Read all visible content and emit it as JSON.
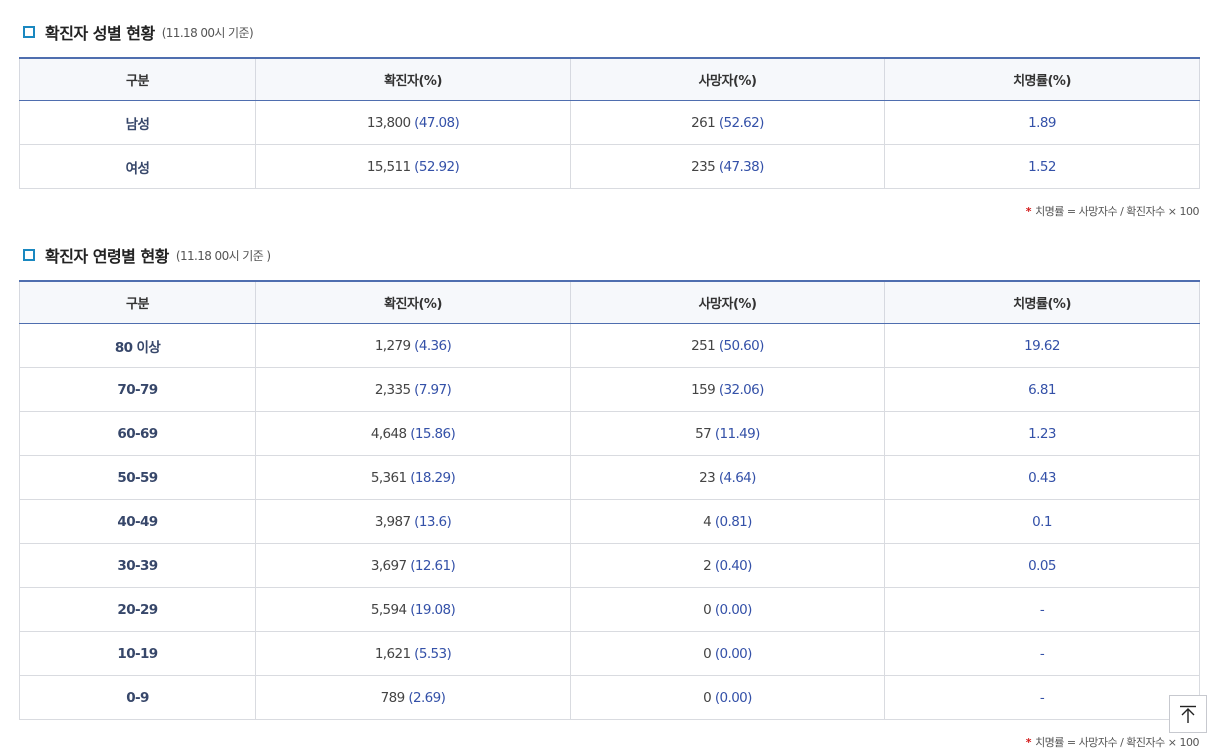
{
  "gender_section": {
    "title": "확진자 성별 현황",
    "subtitle": "(11.18 00시 기준)",
    "headers": [
      "구분",
      "확진자(%)",
      "사망자(%)",
      "치명률(%)"
    ],
    "rows": [
      {
        "group": "남성",
        "confirmed": "13,800",
        "confirmed_pct": "(47.08)",
        "deaths": "261",
        "deaths_pct": "(52.62)",
        "fatality": "1.89"
      },
      {
        "group": "여성",
        "confirmed": "15,511",
        "confirmed_pct": "(52.92)",
        "deaths": "235",
        "deaths_pct": "(47.38)",
        "fatality": "1.52"
      }
    ],
    "note_star": "*",
    "note": "치명률 = 사망자수 / 확진자수 × 100"
  },
  "age_section": {
    "title": "확진자 연령별 현황",
    "subtitle": "(11.18 00시 기준 )",
    "headers": [
      "구분",
      "확진자(%)",
      "사망자(%)",
      "치명률(%)"
    ],
    "rows": [
      {
        "group": "80 이상",
        "confirmed": "1,279",
        "confirmed_pct": "(4.36)",
        "deaths": "251",
        "deaths_pct": "(50.60)",
        "fatality": "19.62"
      },
      {
        "group": "70-79",
        "confirmed": "2,335",
        "confirmed_pct": "(7.97)",
        "deaths": "159",
        "deaths_pct": "(32.06)",
        "fatality": "6.81"
      },
      {
        "group": "60-69",
        "confirmed": "4,648",
        "confirmed_pct": "(15.86)",
        "deaths": "57",
        "deaths_pct": "(11.49)",
        "fatality": "1.23"
      },
      {
        "group": "50-59",
        "confirmed": "5,361",
        "confirmed_pct": "(18.29)",
        "deaths": "23",
        "deaths_pct": "(4.64)",
        "fatality": "0.43"
      },
      {
        "group": "40-49",
        "confirmed": "3,987",
        "confirmed_pct": "(13.6)",
        "deaths": "4",
        "deaths_pct": "(0.81)",
        "fatality": "0.1"
      },
      {
        "group": "30-39",
        "confirmed": "3,697",
        "confirmed_pct": "(12.61)",
        "deaths": "2",
        "deaths_pct": "(0.40)",
        "fatality": "0.05"
      },
      {
        "group": "20-29",
        "confirmed": "5,594",
        "confirmed_pct": "(19.08)",
        "deaths": "0",
        "deaths_pct": "(0.00)",
        "fatality": "-"
      },
      {
        "group": "10-19",
        "confirmed": "1,621",
        "confirmed_pct": "(5.53)",
        "deaths": "0",
        "deaths_pct": "(0.00)",
        "fatality": "-"
      },
      {
        "group": "0-9",
        "confirmed": "789",
        "confirmed_pct": "(2.69)",
        "deaths": "0",
        "deaths_pct": "(0.00)",
        "fatality": "-"
      }
    ],
    "note_star": "*",
    "note": "치명률 = 사망자수 / 확진자수 × 100"
  },
  "scroll_top": {
    "icon": "arrow-up-to-top-icon"
  },
  "colors": {
    "accent": "#4f6eaf",
    "icon": "#1a88c0",
    "value": "#3451a8",
    "note_star": "#d31a1a"
  }
}
